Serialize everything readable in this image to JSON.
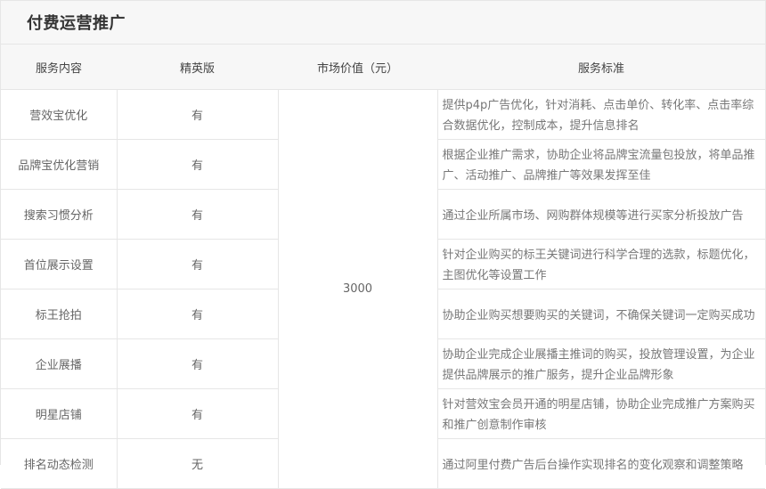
{
  "section": {
    "title": "付费运营推广"
  },
  "table": {
    "headers": [
      "服务内容",
      "精英版",
      "市场价值（元）",
      "服务标准"
    ],
    "price": "3000",
    "rows": [
      {
        "name": "营效宝优化",
        "edition": "有",
        "standard": "提供p4p广告优化，针对消耗、点击单价、转化率、点击率综合数据优化，控制成本，提升信息排名"
      },
      {
        "name": "品牌宝优化营销",
        "edition": "有",
        "standard": "根据企业推广需求，协助企业将品牌宝流量包投放，将单品推广、活动推广、品牌推广等效果发挥至佳"
      },
      {
        "name": "搜索习惯分析",
        "edition": "有",
        "standard": "通过企业所属市场、网购群体规模等进行买家分析投放广告"
      },
      {
        "name": "首位展示设置",
        "edition": "有",
        "standard": "针对企业购买的标王关键词进行科学合理的选款，标题优化，主图优化等设置工作"
      },
      {
        "name": "标王抢拍",
        "edition": "有",
        "standard": "协助企业购买想要购买的关键词，不确保关键词一定购买成功"
      },
      {
        "name": "企业展播",
        "edition": "有",
        "standard": "协助企业完成企业展播主推词的购买，投放管理设置，为企业提供品牌展示的推广服务，提升企业品牌形象"
      },
      {
        "name": "明星店铺",
        "edition": "有",
        "standard": "针对营效宝会员开通的明星店铺，协助企业完成推广方案购买和推广创意制作审核"
      },
      {
        "name": "排名动态检测",
        "edition": "无",
        "standard": "通过阿里付费广告后台操作实现排名的变化观察和调整策略"
      }
    ]
  }
}
